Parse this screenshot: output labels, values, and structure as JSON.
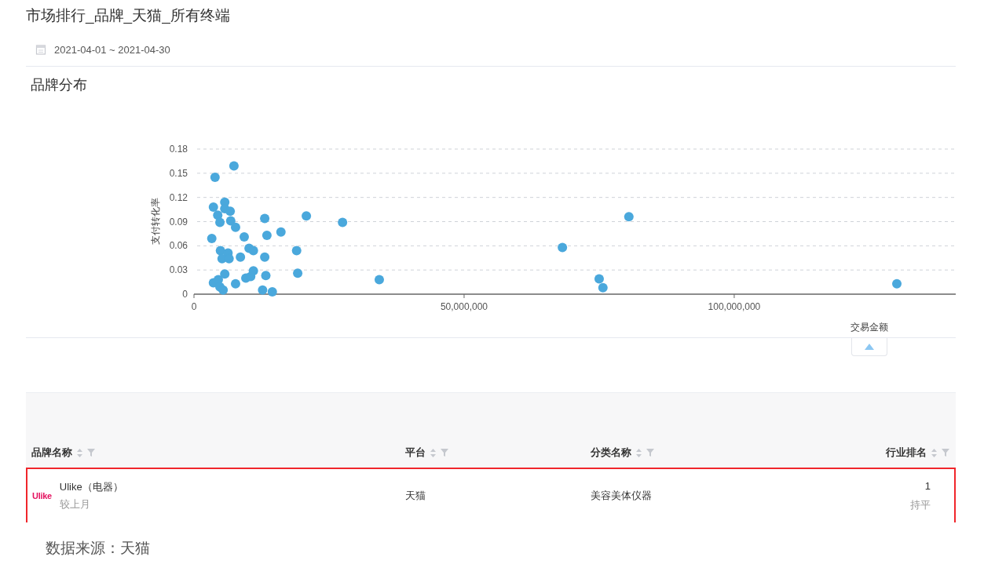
{
  "title": "市场排行_品牌_天猫_所有终端",
  "date_range": "2021-04-01 ~ 2021-04-30",
  "section_title": "品牌分布",
  "chart_data": {
    "type": "scatter",
    "xlabel": "交易金额",
    "ylabel": "支付转化率",
    "x": [
      3900000,
      7400000,
      3600000,
      4400000,
      4800000,
      5700000,
      5700000,
      6700000,
      6800000,
      7700000,
      3300000,
      9300000,
      13100000,
      13500000,
      16100000,
      20800000,
      27500000,
      4900000,
      5200000,
      6300000,
      6500000,
      8600000,
      10200000,
      11000000,
      13100000,
      19000000,
      19200000,
      3600000,
      4500000,
      4800000,
      5500000,
      5700000,
      5400000,
      7700000,
      9600000,
      10500000,
      11000000,
      12700000,
      13300000,
      14500000,
      34300000,
      68200000,
      75000000,
      75700000,
      80500000,
      130100000
    ],
    "values": [
      0.145,
      0.159,
      0.108,
      0.098,
      0.089,
      0.114,
      0.106,
      0.103,
      0.091,
      0.083,
      0.069,
      0.071,
      0.094,
      0.073,
      0.077,
      0.097,
      0.089,
      0.054,
      0.044,
      0.051,
      0.044,
      0.046,
      0.057,
      0.054,
      0.046,
      0.054,
      0.026,
      0.014,
      0.018,
      0.009,
      null,
      0.025,
      0.005,
      0.013,
      0.02,
      0.022,
      0.029,
      0.005,
      0.023,
      0.003,
      0.018,
      0.058,
      0.019,
      0.008,
      0.096,
      0.013
    ],
    "grid": true,
    "xlim": [
      0,
      141000000
    ],
    "ylim": [
      0,
      0.18
    ],
    "xticks": [
      {
        "value": 0,
        "label": "0"
      },
      {
        "value": 50000000,
        "label": "50,000,000"
      },
      {
        "value": 100000000,
        "label": "100,000,000"
      }
    ],
    "yticks": [
      {
        "value": 0,
        "label": "0"
      },
      {
        "value": 0.03,
        "label": "0.03"
      },
      {
        "value": 0.06,
        "label": "0.06"
      },
      {
        "value": 0.09,
        "label": "0.09"
      },
      {
        "value": 0.12,
        "label": "0.12"
      },
      {
        "value": 0.15,
        "label": "0.15"
      },
      {
        "value": 0.18,
        "label": "0.18"
      }
    ]
  },
  "chart_expanded": true,
  "table": {
    "columns": [
      "品牌名称",
      "平台",
      "分类名称",
      "行业排名"
    ],
    "rows": [
      {
        "selected": true,
        "logo": "Ulike",
        "brand": "Ulike（电器）",
        "compare_label": "较上月",
        "platform": "天猫",
        "category": "美容美体仪器",
        "rank": "1",
        "rank_change": "持平"
      }
    ]
  },
  "source": "数据来源：天猫"
}
